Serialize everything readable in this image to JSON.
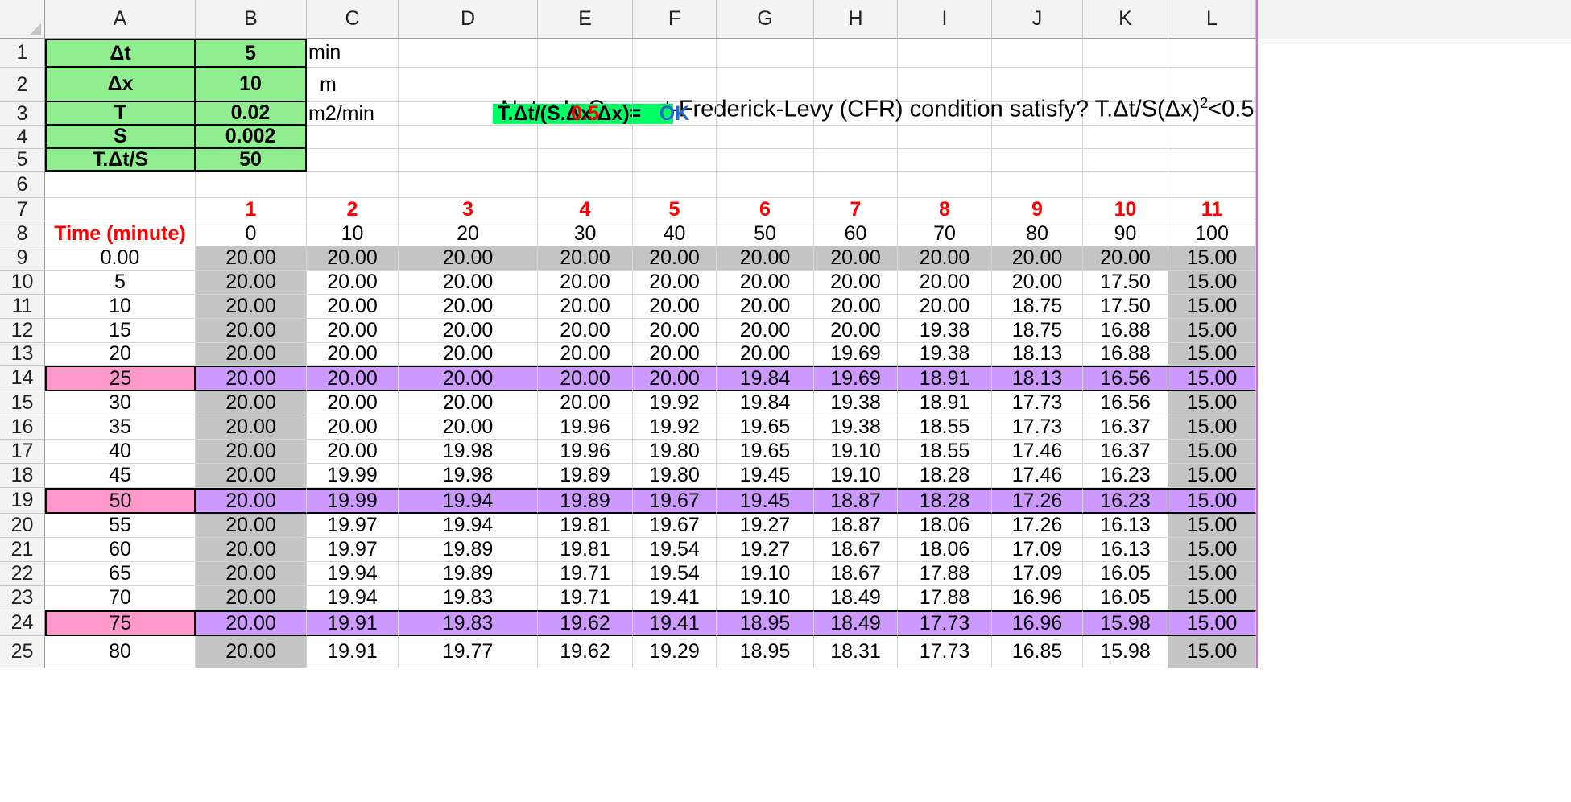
{
  "column_letters": [
    "A",
    "B",
    "C",
    "D",
    "E",
    "F",
    "G",
    "H",
    "I",
    "J",
    "K",
    "L"
  ],
  "row_numbers": [
    "1",
    "2",
    "3",
    "4",
    "5",
    "6",
    "7",
    "8",
    "9",
    "10",
    "11",
    "12",
    "13",
    "14",
    "15",
    "16",
    "17",
    "18",
    "19",
    "20",
    "21",
    "22",
    "23",
    "24",
    "25"
  ],
  "params": [
    {
      "label": "Δt",
      "value": "5",
      "unit": "min"
    },
    {
      "label": "Δx",
      "value": "10",
      "unit": "m"
    },
    {
      "label": "T",
      "value": "0.02",
      "unit": "m2/min"
    },
    {
      "label": "S",
      "value": "0.002",
      "unit": ""
    },
    {
      "label": "T.Δt/S",
      "value": "50",
      "unit": ""
    }
  ],
  "note": {
    "text_before_sup": "Note: Is Courant-Frederick-Levy (CFR) condition satisfy? T.Δt/S(Δx)",
    "sup": "2",
    "text_after_sup": "<0.5"
  },
  "cfr": {
    "label": "T.Δt/(S.Δx.Δx)=",
    "value": "0.5",
    "status": "OK"
  },
  "node_numbers": [
    "1",
    "2",
    "3",
    "4",
    "5",
    "6",
    "7",
    "8",
    "9",
    "10",
    "11"
  ],
  "time_header": "Time (minute)",
  "distances": [
    "0",
    "10",
    "20",
    "30",
    "40",
    "50",
    "60",
    "70",
    "80",
    "90",
    "100"
  ],
  "times": [
    "0.00",
    "5",
    "10",
    "15",
    "20",
    "25",
    "30",
    "35",
    "40",
    "45",
    "50",
    "55",
    "60",
    "65",
    "70",
    "75",
    "80"
  ],
  "values": [
    [
      "20.00",
      "20.00",
      "20.00",
      "20.00",
      "20.00",
      "20.00",
      "20.00",
      "20.00",
      "20.00",
      "20.00",
      "15.00"
    ],
    [
      "20.00",
      "20.00",
      "20.00",
      "20.00",
      "20.00",
      "20.00",
      "20.00",
      "20.00",
      "20.00",
      "17.50",
      "15.00"
    ],
    [
      "20.00",
      "20.00",
      "20.00",
      "20.00",
      "20.00",
      "20.00",
      "20.00",
      "20.00",
      "18.75",
      "17.50",
      "15.00"
    ],
    [
      "20.00",
      "20.00",
      "20.00",
      "20.00",
      "20.00",
      "20.00",
      "20.00",
      "19.38",
      "18.75",
      "16.88",
      "15.00"
    ],
    [
      "20.00",
      "20.00",
      "20.00",
      "20.00",
      "20.00",
      "20.00",
      "19.69",
      "19.38",
      "18.13",
      "16.88",
      "15.00"
    ],
    [
      "20.00",
      "20.00",
      "20.00",
      "20.00",
      "20.00",
      "19.84",
      "19.69",
      "18.91",
      "18.13",
      "16.56",
      "15.00"
    ],
    [
      "20.00",
      "20.00",
      "20.00",
      "20.00",
      "19.92",
      "19.84",
      "19.38",
      "18.91",
      "17.73",
      "16.56",
      "15.00"
    ],
    [
      "20.00",
      "20.00",
      "20.00",
      "19.96",
      "19.92",
      "19.65",
      "19.38",
      "18.55",
      "17.73",
      "16.37",
      "15.00"
    ],
    [
      "20.00",
      "20.00",
      "19.98",
      "19.96",
      "19.80",
      "19.65",
      "19.10",
      "18.55",
      "17.46",
      "16.37",
      "15.00"
    ],
    [
      "20.00",
      "19.99",
      "19.98",
      "19.89",
      "19.80",
      "19.45",
      "19.10",
      "18.28",
      "17.46",
      "16.23",
      "15.00"
    ],
    [
      "20.00",
      "19.99",
      "19.94",
      "19.89",
      "19.67",
      "19.45",
      "18.87",
      "18.28",
      "17.26",
      "16.23",
      "15.00"
    ],
    [
      "20.00",
      "19.97",
      "19.94",
      "19.81",
      "19.67",
      "19.27",
      "18.87",
      "18.06",
      "17.26",
      "16.13",
      "15.00"
    ],
    [
      "20.00",
      "19.97",
      "19.89",
      "19.81",
      "19.54",
      "19.27",
      "18.67",
      "18.06",
      "17.09",
      "16.13",
      "15.00"
    ],
    [
      "20.00",
      "19.94",
      "19.89",
      "19.71",
      "19.54",
      "19.10",
      "18.67",
      "17.88",
      "17.09",
      "16.05",
      "15.00"
    ],
    [
      "20.00",
      "19.94",
      "19.83",
      "19.71",
      "19.41",
      "19.10",
      "18.49",
      "17.88",
      "16.96",
      "16.05",
      "15.00"
    ],
    [
      "20.00",
      "19.91",
      "19.83",
      "19.62",
      "19.41",
      "18.95",
      "18.49",
      "17.73",
      "16.96",
      "15.98",
      "15.00"
    ],
    [
      "20.00",
      "19.91",
      "19.77",
      "19.62",
      "19.29",
      "18.95",
      "18.31",
      "17.73",
      "16.85",
      "15.98",
      "15.00"
    ]
  ],
  "highlight_times": [
    "25",
    "50",
    "75"
  ],
  "colors": {
    "param_green": "#90ee90",
    "cfr_label_green": "#00ff66",
    "boundary_gray": "#c4c4c4",
    "highlight_purple": "#cc99ff",
    "highlight_pink": "#ff99cc",
    "header_red": "#ff0000",
    "ok_blue": "#2467c7"
  }
}
